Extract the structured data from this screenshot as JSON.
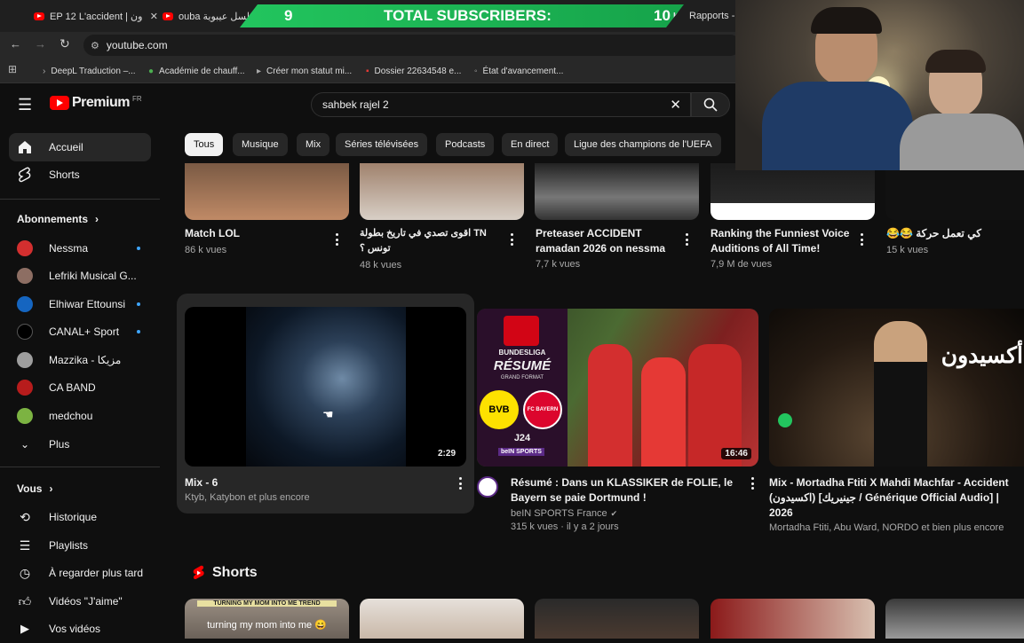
{
  "browser": {
    "tabs": [
      {
        "label": "EP 12 L'accident | ون"
      },
      {
        "label": "ouba مسلسل عيبوية"
      },
      {
        "label": "Rapports - i"
      }
    ],
    "url": "youtube.com",
    "bookmarks": [
      "DeepL Traduction –...",
      "Académie de chauff...",
      "Créer mon statut mi...",
      "Dossier 22634548 e...",
      "État d'avancement..."
    ]
  },
  "overlay": {
    "left_num": "9",
    "title": "TOTAL SUBSCRIBERS:",
    "right_num": "10",
    "suffix": "K!"
  },
  "header": {
    "logo": "Premium",
    "region": "FR",
    "search_value": "sahbek rajel 2"
  },
  "chips": [
    "Tous",
    "Musique",
    "Mix",
    "Séries télévisées",
    "Podcasts",
    "En direct",
    "Ligue des champions de l'UEFA"
  ],
  "sidebar": {
    "top": [
      {
        "label": "Accueil"
      },
      {
        "label": "Shorts"
      }
    ],
    "subs_title": "Abonnements",
    "channels": [
      {
        "label": "Nessma",
        "color": "#d32f2f"
      },
      {
        "label": "Lefriki Musical G...",
        "color": "#8d6e63"
      },
      {
        "label": "Elhiwar Ettounsi",
        "color": "#1565c0"
      },
      {
        "label": "CANAL+ Sport",
        "color": "#000000"
      },
      {
        "label": "Mazzika - مزيكا",
        "color": "#9e9e9e"
      },
      {
        "label": "CA BAND",
        "color": "#b71c1c"
      },
      {
        "label": "medchou",
        "color": "#7cb342"
      }
    ],
    "more": "Plus",
    "you_title": "Vous",
    "you_items": [
      {
        "label": "Historique"
      },
      {
        "label": "Playlists"
      },
      {
        "label": "À regarder plus tard"
      },
      {
        "label": "Vidéos \"J'aime\""
      },
      {
        "label": "Vos vidéos"
      }
    ]
  },
  "row1": [
    {
      "title": "Match LOL",
      "meta": "86 k vues"
    },
    {
      "title": "TN اقوى تصدي في تاريخ بطولة تونس ؟",
      "meta": "48 k vues"
    },
    {
      "title": "Preteaser ACCIDENT ramadan 2026 on nessma",
      "meta": "7,7 k vues"
    },
    {
      "title": "Ranking the Funniest Voice Auditions of All Time!",
      "meta": "7,9 M de vues"
    },
    {
      "title": "كي تعمل حركة 😂😂",
      "meta": "15 k vues"
    }
  ],
  "row2": [
    {
      "title": "Mix - 6",
      "meta": "Ktyb, Katybon et plus encore",
      "duration": "2:29"
    },
    {
      "title": "Résumé : Dans un KLASSIKER de FOLIE, le Bayern se paie Dortmund !",
      "channel": "beIN SPORTS France",
      "meta": "315 k vues · il y a 2 jours",
      "duration": "16:46",
      "thumb_text": {
        "league": "BUNDESLIGA",
        "word": "RÉSUMÉ",
        "sub": "GRAND FORMAT",
        "bvb": "BVB",
        "fcb": "FC BAYERN",
        "round": "J24",
        "brand": "beIN SPORTS"
      }
    },
    {
      "title": "Mix - Mortadha Ftiti X Mahdi Machfar - Accident (اكسيدون) [جينيريك / Générique Official Audio] | 2026",
      "meta": "Mortadha Ftiti, Abu Ward, NORDO et bien plus encore",
      "thumb_text": "أكسيدون"
    }
  ],
  "shorts": {
    "title": "Shorts",
    "first_caption": "turning my mom into me 😄",
    "first_banner": "TURNING MY MOM INTO ME TREND"
  }
}
